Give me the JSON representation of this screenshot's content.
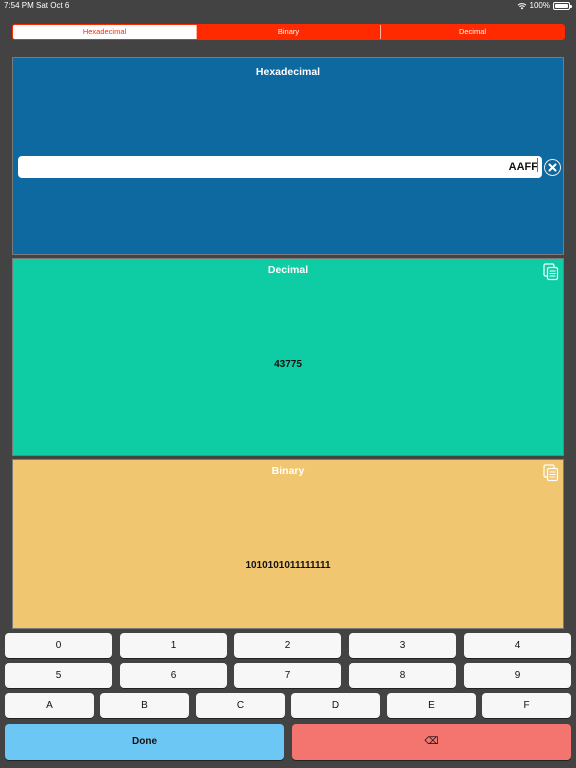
{
  "status": {
    "time": "7:54 PM",
    "date": "Sat Oct 6",
    "battery": "100%"
  },
  "tabs": [
    {
      "label": "Hexadecimal",
      "active": true
    },
    {
      "label": "Binary",
      "active": false
    },
    {
      "label": "Decimal",
      "active": false
    }
  ],
  "hex_panel": {
    "title": "Hexadecimal",
    "input_value": "AAFF",
    "color": "#0d69a0"
  },
  "dec_panel": {
    "title": "Decimal",
    "value": "43775",
    "color": "#0ecda4"
  },
  "bin_panel": {
    "title": "Binary",
    "value": "1010101011111111",
    "color": "#f1c671"
  },
  "keyboard": {
    "row1": [
      "0",
      "1",
      "2",
      "3",
      "4"
    ],
    "row2": [
      "5",
      "6",
      "7",
      "8",
      "9"
    ],
    "row3": [
      "A",
      "B",
      "C",
      "D",
      "E",
      "F"
    ],
    "done_label": "Done",
    "backspace_label": "⌫"
  },
  "icons": {
    "clear": "clear-circle-icon",
    "copy": "copy-icon",
    "wifi": "wifi-icon",
    "battery": "battery-icon"
  }
}
